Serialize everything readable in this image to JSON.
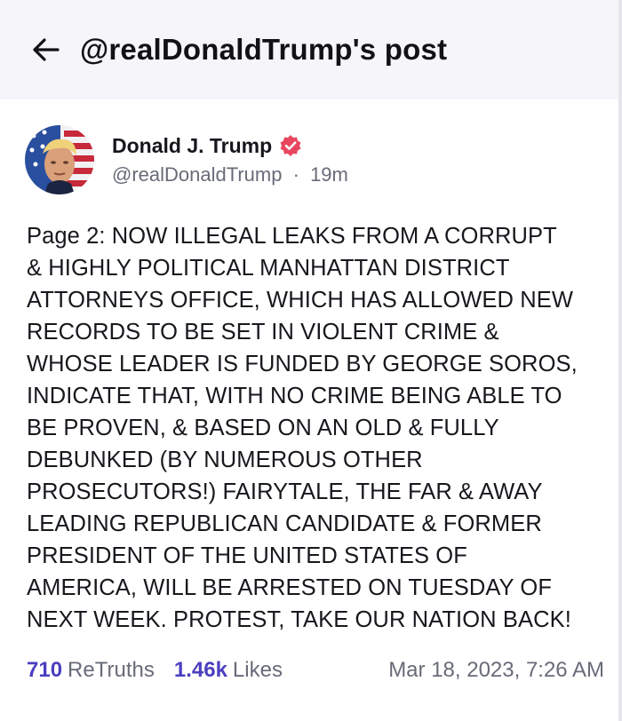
{
  "header": {
    "title": "@realDonaldTrump's post",
    "back_icon": "arrow-left-icon"
  },
  "author": {
    "display_name": "Donald J. Trump",
    "handle": "@realDonaldTrump",
    "separator": "·",
    "time_ago": "19m",
    "verified_icon": "verified-badge-icon",
    "verified_color": "#e8475f"
  },
  "post": {
    "lines": [
      "Page 2: NOW ILLEGAL LEAKS FROM A CORRUPT",
      "& HIGHLY POLITICAL MANHATTAN DISTRICT",
      "ATTORNEYS OFFICE, WHICH HAS ALLOWED NEW",
      "RECORDS TO BE SET IN VIOLENT CRIME &",
      "WHOSE LEADER IS FUNDED BY GEORGE SOROS,",
      "INDICATE THAT, WITH NO CRIME BEING ABLE TO",
      "BE PROVEN, & BASED ON AN OLD & FULLY",
      "DEBUNKED (BY NUMEROUS OTHER",
      "PROSECUTORS!) FAIRYTALE, THE FAR & AWAY",
      "LEADING REPUBLICAN CANDIDATE & FORMER",
      "PRESIDENT OF THE UNITED STATES OF",
      "AMERICA, WILL BE ARRESTED ON TUESDAY OF",
      "NEXT WEEK. PROTEST, TAKE OUR NATION BACK!"
    ]
  },
  "stats": {
    "retruths_count": "710",
    "retruths_label": "ReTruths",
    "likes_count": "1.46k",
    "likes_label": "Likes",
    "timestamp": "Mar 18, 2023, 7:26 AM"
  },
  "colors": {
    "accent": "#4b3fc0",
    "header_bg": "#f5f5fa",
    "muted_text": "#686b78"
  }
}
